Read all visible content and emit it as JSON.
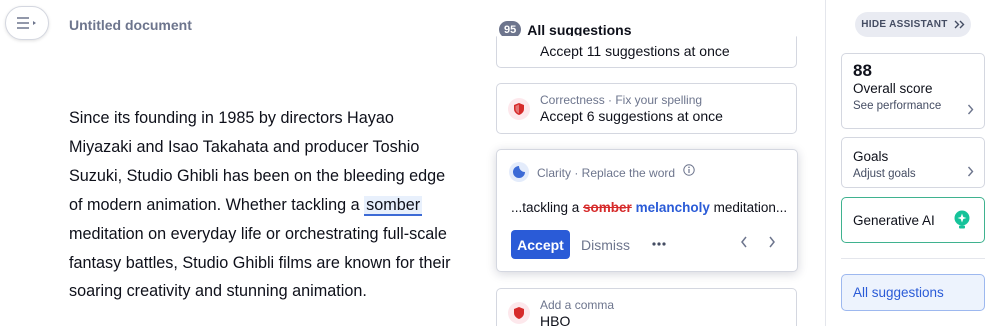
{
  "document": {
    "title": "Untitled document",
    "text_before": "Since its founding in 1985 by directors Hayao Miyazaki and Isao Takahata and producer Toshio Suzuki, Studio Ghibli has been on the bleeding edge of modern animation. Whether tackling a ",
    "highlighted_word": "somber",
    "text_after": " meditation on everyday life or orchestrating full-scale fantasy battles, Studio Ghibli films are known for their soaring creativity and stunning animation."
  },
  "suggestions": {
    "count": "95",
    "header": "All suggestions",
    "cards": [
      {
        "subtitle": "",
        "main": "Accept 11 suggestions at once",
        "icon": "shield-icon"
      },
      {
        "subtitle": "Correctness · Fix your spelling",
        "main": "Accept 6 suggestions at once",
        "icon": "shield-icon"
      },
      {
        "subtitle": "Add a comma",
        "main": "HBO",
        "icon": "shield-icon"
      }
    ],
    "active": {
      "category": "Clarity · Replace the word",
      "context_before": "...tackling a ",
      "removed": "somber",
      "inserted": "melancholy",
      "context_after": " meditation...",
      "accept_label": "Accept",
      "dismiss_label": "Dismiss",
      "icon": "clarity-icon"
    }
  },
  "sidebar": {
    "hide_label": "HIDE ASSISTANT",
    "score": {
      "value": "88",
      "label": "Overall score",
      "link": "See performance"
    },
    "goals": {
      "title": "Goals",
      "sub": "Adjust goals"
    },
    "genai": {
      "label": "Generative AI"
    },
    "all_suggestions": "All suggestions"
  },
  "colors": {
    "accent": "#2a5bd7",
    "correctness": "#d62b2b",
    "genai": "#15c39a"
  }
}
